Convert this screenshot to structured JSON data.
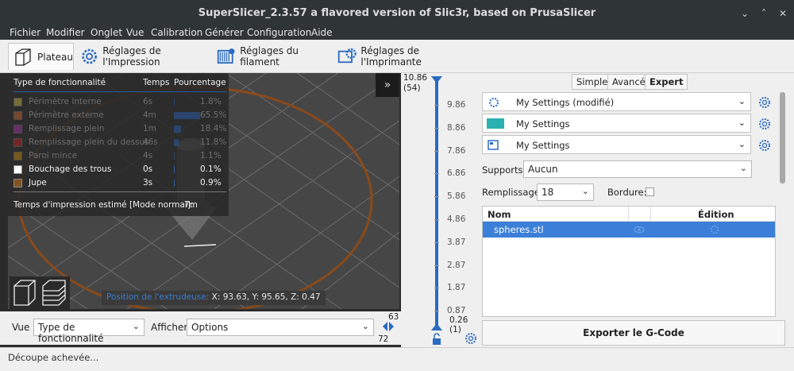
{
  "window": {
    "title": "SuperSlicer_2.3.57 a flavored version of Slic3r, based on PrusaSlicer",
    "controls": [
      "⌄",
      "˄",
      "✕"
    ]
  },
  "menu": [
    "Fichier",
    "Modifier",
    "Onglet",
    "Vue",
    "Calibration",
    "Générer",
    "Configuration",
    "Aide"
  ],
  "tabs": {
    "plateau": "Plateau",
    "print": "Réglages de l'Impression",
    "filament": "Réglages du filament",
    "printer": "Réglages de l'Imprimante"
  },
  "legend": {
    "headers": {
      "type": "Type de fonctionnalité",
      "time": "Temps",
      "percent": "Pourcentage"
    },
    "rows": [
      {
        "name": "Périmètre interne",
        "time": "6s",
        "percent": "1.8%",
        "fraction": 0.018,
        "color": "#ffe64d",
        "active": false
      },
      {
        "name": "Périmètre externe",
        "time": "4m",
        "percent": "65.5%",
        "fraction": 0.655,
        "color": "#ff7d38",
        "active": false
      },
      {
        "name": "Remplissage plein",
        "time": "1m",
        "percent": "18.4%",
        "fraction": 0.184,
        "color": "#d732d7",
        "active": false
      },
      {
        "name": "Remplissage plein du dessus",
        "time": "46s",
        "percent": "11.8%",
        "fraction": 0.118,
        "color": "#ff1a1a",
        "active": false
      },
      {
        "name": "Paroi mince",
        "time": "4s",
        "percent": "1.1%",
        "fraction": 0.011,
        "color": "#ffb000",
        "active": false
      },
      {
        "name": "Bouchage des trous",
        "time": "0s",
        "percent": "0.1%",
        "fraction": 0.001,
        "color": "#ffffff",
        "active": true
      },
      {
        "name": "Jupe",
        "time": "3s",
        "percent": "0.9%",
        "fraction": 0.009,
        "color": "#845321",
        "active": true
      }
    ],
    "estimate_label": "Temps d'impression estimé [Mode normal]:",
    "estimate_value": "7m"
  },
  "extruder": {
    "label": "Position de l'extrudeuse:",
    "coords": "X: 93.63, Y: 95.65, Z: 0.47"
  },
  "bottom": {
    "view_label": "Vue",
    "view_value": "Type de fonctionnalité",
    "show_label": "Afficher",
    "show_value": "Options",
    "hslider_max": "63",
    "hslider_min": "72"
  },
  "vslider": {
    "top_value": "10.86",
    "top_layer": "(54)",
    "ticks": [
      "9.86",
      "8.86",
      "7.86",
      "6.86",
      "5.86",
      "4.86",
      "3.87",
      "2.87",
      "1.87",
      "0.87"
    ],
    "bottom_value": "0.26",
    "bottom_layer": "(1)"
  },
  "modes": {
    "simple": "Simple",
    "advanced": "Avancé",
    "expert": "Expert"
  },
  "presets": {
    "print": "My Settings (modifié)",
    "filament": "My Settings",
    "printer": "My Settings"
  },
  "supports": {
    "label": "Supports:",
    "value": "Aucun"
  },
  "infill": {
    "label": "Remplissage:",
    "value": "18"
  },
  "brim": {
    "label": "Bordure:"
  },
  "objects": {
    "col_name": "Nom",
    "col_edit": "Édition",
    "items": [
      {
        "name": "spheres.stl"
      }
    ]
  },
  "export": "Exporter le G-Code",
  "status": "Découpe achevée..."
}
